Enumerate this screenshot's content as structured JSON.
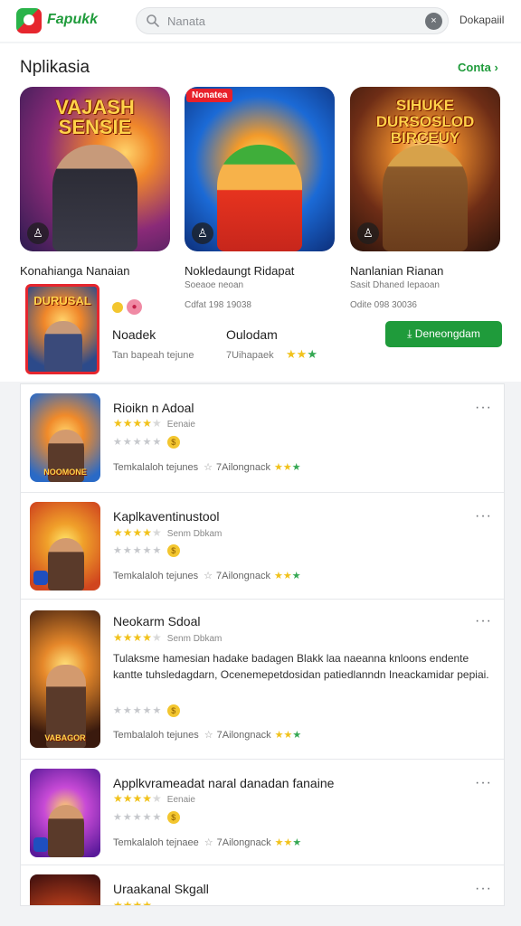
{
  "header": {
    "brand": "Fapukk",
    "search_value": "Nanata",
    "clear_label": "×",
    "right_link": "Dokapaiil"
  },
  "section": {
    "title": "Nplikasia",
    "see_all": "Conta",
    "cards": [
      {
        "banner": "VAJASH SENSIE",
        "tag": "",
        "name": "Konahianga Nanaian",
        "sub": "",
        "meta": ""
      },
      {
        "banner": "",
        "tag": "Nonatea",
        "name": "Nokledaungt Ridapat",
        "sub": "Soeaoe neoan",
        "meta": "Cdfat 198 19038"
      },
      {
        "banner": "SIHUKE DURSOSLOD BIRCEUY",
        "tag": "",
        "name": "Nanlanian Rianan",
        "sub": "Sasit Dhaned Iepaoan",
        "meta": "Odite 098 30036"
      }
    ],
    "featured": {
      "thumb_title": "DURUSAL",
      "label_left": "Noadek",
      "label_right": "Oulodam",
      "sub_left": "Tan bapeah tejune",
      "sub_right": "7Uihapaek",
      "install_label": "Deneongdam"
    }
  },
  "list": [
    {
      "title": "Rioikn n Adoal",
      "rating_text": "Eenaie",
      "foot_left": "Temkalaloh tejunes",
      "foot_right": "7Ailongnack",
      "thumb_label": "NOOMONE"
    },
    {
      "title": "Kaplkaventinustool",
      "rating_text": "Senm Dbkam",
      "foot_left": "Temkalaloh tejunes",
      "foot_right": "7Ailongnack",
      "thumb_label": ""
    },
    {
      "title": "Neokarm Sdoal",
      "rating_text": "Senm Dbkam",
      "description": "Tulaksme hamesian hadake badagen Blakk laa naeanna knloons endente kantte tuhsledagdarn, Ocenemepetdosidan patiedlanndn Ineackamidar pepiai.",
      "foot_left": "Tembalaloh tejunes",
      "foot_right": "7Ailongnack",
      "thumb_label": "VABAGOR"
    },
    {
      "title": "Applkvrameadat naral danadan fanaine",
      "rating_text": "Eenaie",
      "foot_left": "Temkalaloh tejnaee",
      "foot_right": "7Ailongnack",
      "thumb_label": ""
    },
    {
      "title": "Uraakanal Skgall",
      "rating_text": "",
      "foot_left": "",
      "foot_right": "",
      "thumb_label": ""
    }
  ]
}
